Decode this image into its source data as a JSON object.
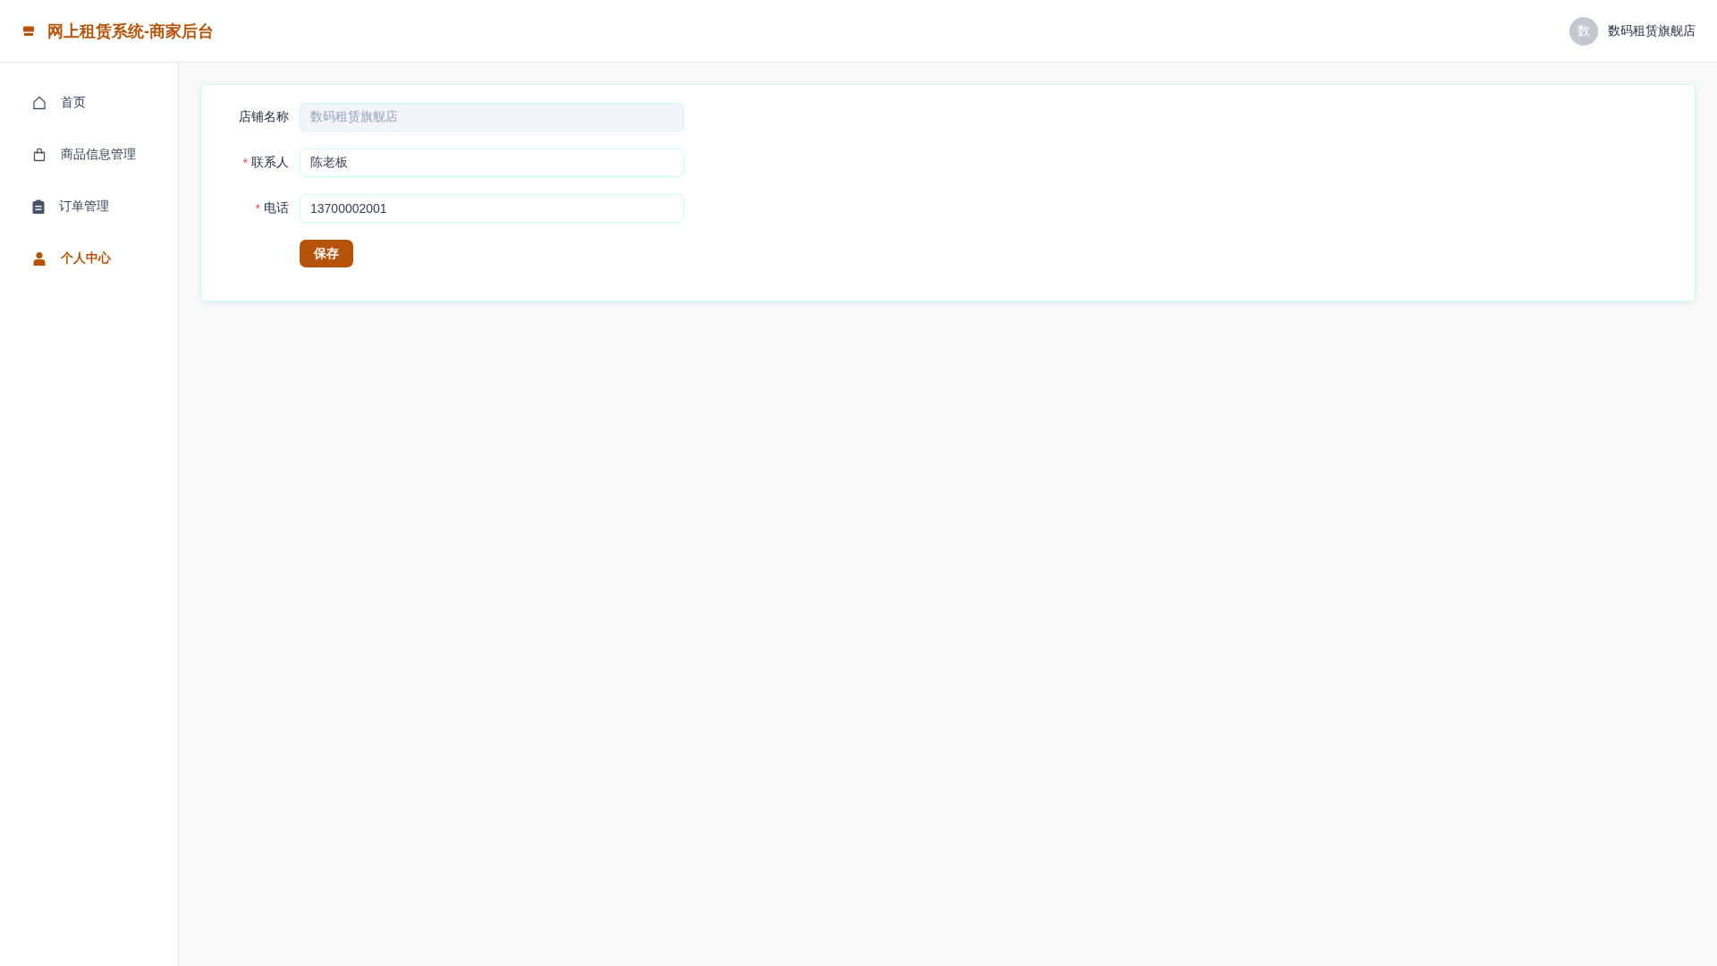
{
  "header": {
    "title": "网上租赁系统-商家后台",
    "user": {
      "avatar_text": "数",
      "name": "数码租赁旗舰店"
    }
  },
  "sidebar": {
    "items": [
      {
        "label": "首页",
        "selected": false
      },
      {
        "label": "商品信息管理",
        "selected": false
      },
      {
        "label": "订单管理",
        "selected": false
      },
      {
        "label": "个人中心",
        "selected": true
      }
    ]
  },
  "form": {
    "fields": [
      {
        "label": "店铺名称",
        "value": "数码租赁旗舰店",
        "disabled": true
      },
      {
        "label": "联系人",
        "required_mark": "*",
        "value": "陈老板",
        "disabled": false
      },
      {
        "label": "电话",
        "required_mark": "*",
        "value": "13700002001",
        "disabled": false
      }
    ],
    "submit_button": "保存"
  }
}
